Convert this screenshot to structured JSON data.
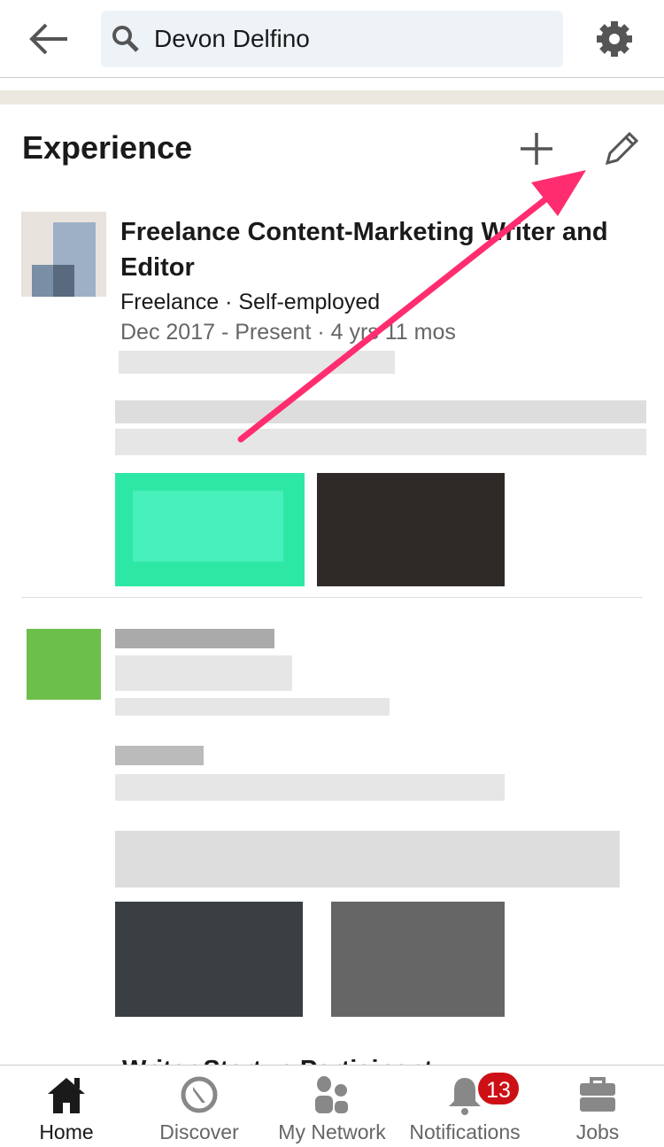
{
  "search": {
    "value": "Devon Delfino",
    "icon": "search-icon"
  },
  "section": {
    "title": "Experience",
    "add_icon": "plus-icon",
    "edit_icon": "pencil-icon"
  },
  "experience": [
    {
      "title": "Freelance Content-Marketing Writer and Editor",
      "company": "Freelance · Self-employed",
      "dates": "Dec 2017 - Present · 4 yrs 11 mos"
    },
    {
      "title": "Writer Startup Participant"
    }
  ],
  "annotation": {
    "arrow_color": "#ff2d6f"
  },
  "nav": {
    "items": [
      {
        "label": "Home",
        "icon": "home-icon",
        "active": true
      },
      {
        "label": "Discover",
        "icon": "compass-icon"
      },
      {
        "label": "My Network",
        "icon": "people-icon"
      },
      {
        "label": "Notifications",
        "icon": "bell-icon",
        "badge": "13"
      },
      {
        "label": "Jobs",
        "icon": "briefcase-icon"
      }
    ]
  },
  "colors": {
    "badge": "#cc1016",
    "search_bg": "#eef3f8"
  }
}
